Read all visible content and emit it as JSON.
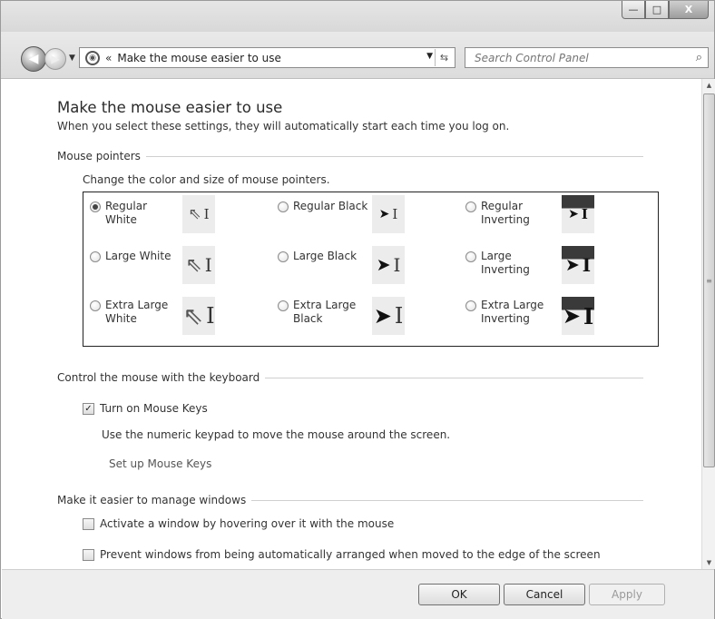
{
  "address": {
    "path_label": "Make the mouse easier to use",
    "search_placeholder": "Search Control Panel"
  },
  "caption": {
    "minimize": "—",
    "maximize": "□",
    "close": "X"
  },
  "page": {
    "title": "Make the mouse easier to use",
    "subtitle": "When you select these settings, they will automatically start each time you log on."
  },
  "pointers": {
    "section_title": "Mouse pointers",
    "instruction": "Change the color and size of mouse pointers.",
    "options": [
      {
        "label_line1": "Regular",
        "label_line2": "White",
        "checked": true
      },
      {
        "label_line1": "Regular Black",
        "label_line2": "",
        "checked": false
      },
      {
        "label_line1": "Regular",
        "label_line2": "Inverting",
        "checked": false
      },
      {
        "label_line1": "Large White",
        "label_line2": "",
        "checked": false
      },
      {
        "label_line1": "Large Black",
        "label_line2": "",
        "checked": false
      },
      {
        "label_line1": "Large",
        "label_line2": "Inverting",
        "checked": false
      },
      {
        "label_line1": "Extra Large",
        "label_line2": "White",
        "checked": false
      },
      {
        "label_line1": "Extra Large",
        "label_line2": "Black",
        "checked": false
      },
      {
        "label_line1": "Extra Large",
        "label_line2": "Inverting",
        "checked": false
      }
    ]
  },
  "keyboard": {
    "section_title": "Control the mouse with the keyboard",
    "mouse_keys_label": "Turn on Mouse Keys",
    "mouse_keys_checked": true,
    "help": "Use the numeric keypad to move the mouse around the screen.",
    "setup_link": "Set up Mouse Keys"
  },
  "windows": {
    "section_title": "Make it easier to manage windows",
    "hover_label": "Activate a window by hovering over it with the mouse",
    "hover_checked": false,
    "arrange_label": "Prevent windows from being automatically arranged when moved to the edge of the screen",
    "arrange_checked": false
  },
  "footer": {
    "ok": "OK",
    "cancel": "Cancel",
    "apply": "Apply"
  }
}
